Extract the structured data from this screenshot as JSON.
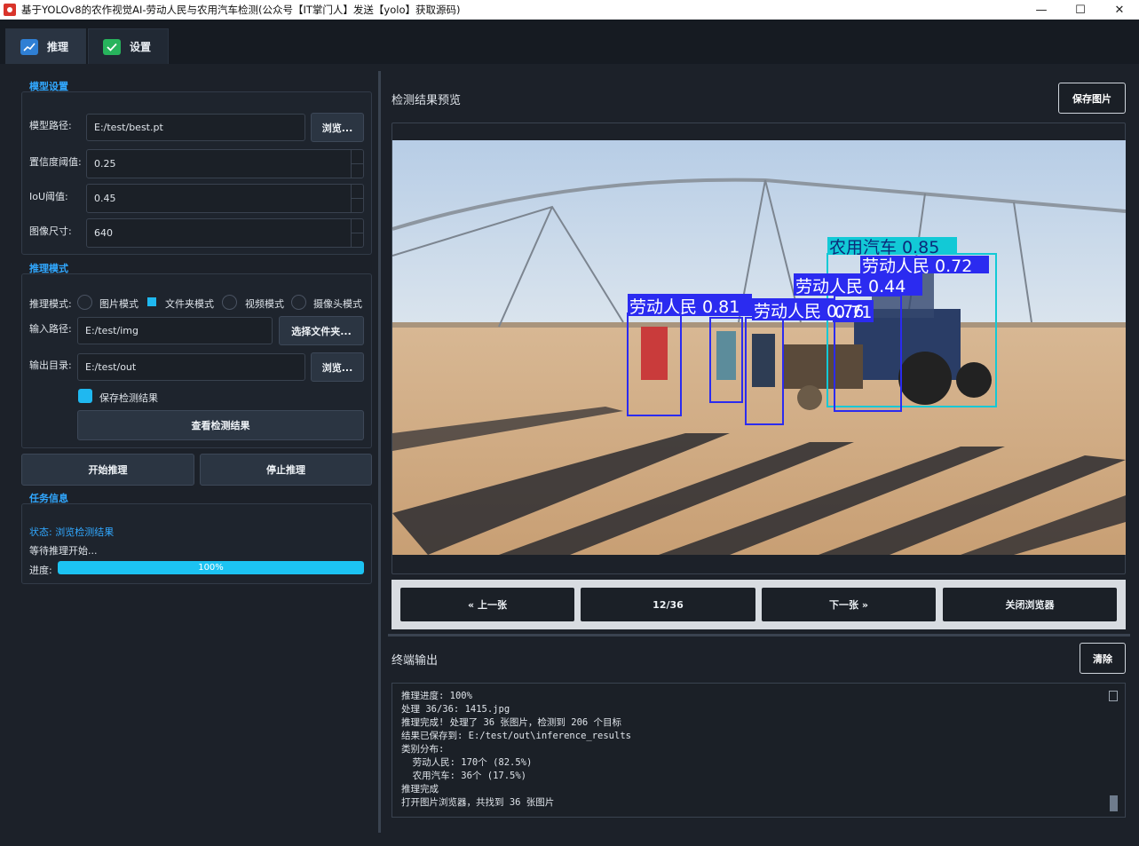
{
  "window": {
    "title": "基于YOLOv8的农作视觉AI-劳动人民与农用汽车检测(公众号【IT掌门人】发送【yolo】获取源码)",
    "controls": [
      "—",
      "☐",
      "✕"
    ]
  },
  "tabs": [
    {
      "label": "推理",
      "icon": "chart-icon"
    },
    {
      "label": "设置",
      "icon": "check-icon"
    }
  ],
  "model_settings": {
    "section_title": "模型设置",
    "model_path_label": "模型路径:",
    "model_path_value": "E:/test/best.pt",
    "browse_label": "浏览...",
    "confidence_label": "置信度阈值:",
    "confidence_value": "0.25",
    "iou_label": "IoU阈值:",
    "iou_value": "0.45",
    "imgsize_label": "图像尺寸:",
    "imgsize_value": "640"
  },
  "inference_mode": {
    "section_title": "推理模式",
    "mode_label": "推理模式:",
    "modes": [
      "图片模式",
      "文件夹模式",
      "视频模式",
      "摄像头模式"
    ],
    "selected_mode": "文件夹模式",
    "input_label": "输入路径:",
    "input_value": "E:/test/img",
    "select_folder_label": "选择文件夹...",
    "output_label": "输出目录:",
    "output_value": "E:/test/out",
    "browse_label": "浏览...",
    "save_results_label": "保存检测结果",
    "save_results_checked": true,
    "view_results_label": "查看检测结果"
  },
  "actions": {
    "start_label": "开始推理",
    "stop_label": "停止推理"
  },
  "task_info": {
    "section_title": "任务信息",
    "status_text": "状态: 浏览检测结果",
    "waiting_text": "等待推理开始...",
    "progress_label": "进度:",
    "progress_value": 100,
    "progress_text": "100%"
  },
  "preview": {
    "title": "检测结果预览",
    "save_image_label": "保存图片",
    "detections": [
      {
        "label": "农用汽车 0.85",
        "color": "#12c9d6"
      },
      {
        "label": "劳动人民 0.72",
        "color": "#2b2bf0"
      },
      {
        "label": "劳动人民 0.44",
        "color": "#2b2bf0"
      },
      {
        "label": "劳动人民 0.81",
        "color": "#2b2bf0"
      },
      {
        "label": "劳动人民 0.76",
        "color": "#2b2bf0"
      },
      {
        "label": "0.71",
        "color": "#2b2bf0"
      }
    ]
  },
  "navigation": {
    "prev_label": "« 上一张",
    "page_text": "12/36",
    "next_label": "下一张 »",
    "close_label": "关闭浏览器"
  },
  "terminal": {
    "title": "终端输出",
    "clear_label": "清除",
    "lines": [
      "推理进度: 100%",
      "处理 36/36: 1415.jpg",
      "推理完成! 处理了 36 张图片，检测到 206 个目标",
      "结果已保存到: E:/test/out\\inference_results",
      "类别分布:",
      "  劳动人民: 170个 (82.5%)",
      "  农用汽车: 36个 (17.5%)",
      "推理完成",
      "打开图片浏览器，共找到 36 张图片"
    ]
  }
}
